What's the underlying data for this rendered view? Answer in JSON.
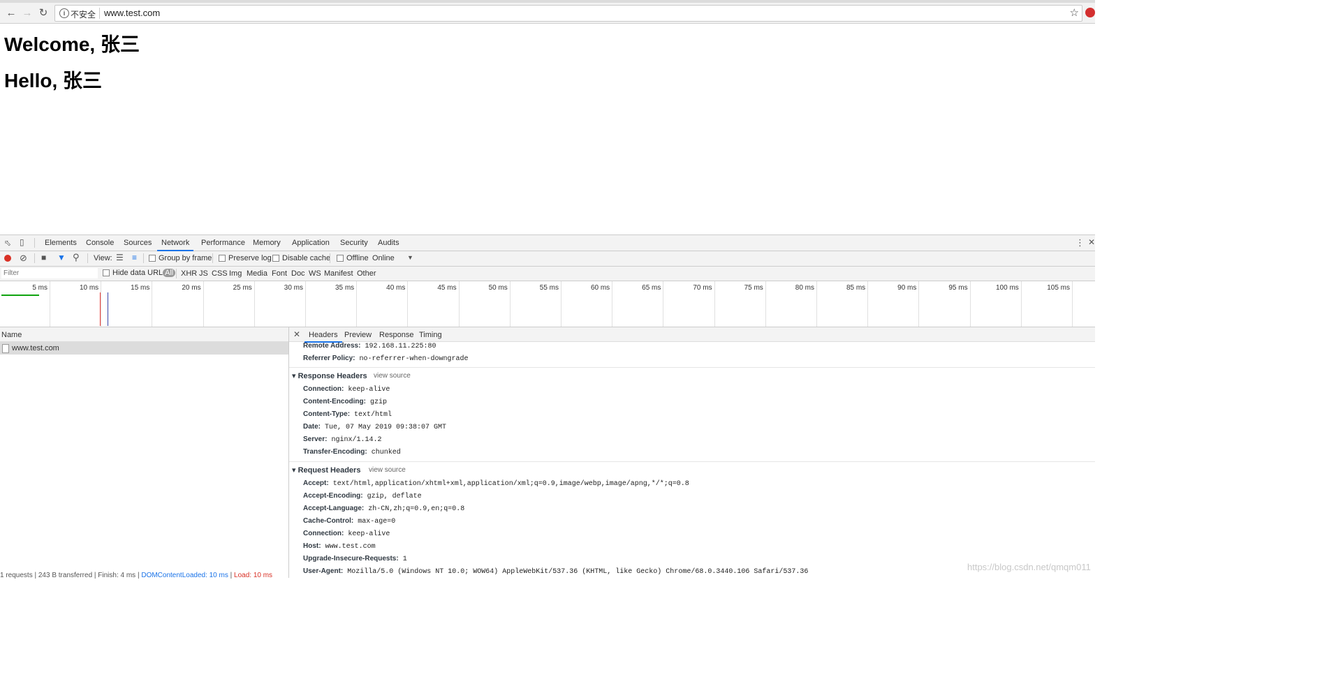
{
  "browser": {
    "security_label": "不安全",
    "url": "www.test.com"
  },
  "page": {
    "heading1": "Welcome, 张三",
    "heading2": "Hello, 张三"
  },
  "devtools": {
    "tabs": [
      "Elements",
      "Console",
      "Sources",
      "Network",
      "Performance",
      "Memory",
      "Application",
      "Security",
      "Audits"
    ],
    "active_tab": "Network",
    "network_toolbar": {
      "view_label": "View:",
      "group_by_frame": "Group by frame",
      "preserve_log": "Preserve log",
      "disable_cache": "Disable cache",
      "offline": "Offline",
      "throttle": "Online"
    },
    "filter": {
      "placeholder": "Filter",
      "hide_data_urls": "Hide data URLs",
      "types": [
        "All",
        "XHR",
        "JS",
        "CSS",
        "Img",
        "Media",
        "Font",
        "Doc",
        "WS",
        "Manifest",
        "Other"
      ]
    },
    "timeline_ticks": [
      "5 ms",
      "10 ms",
      "15 ms",
      "20 ms",
      "25 ms",
      "30 ms",
      "35 ms",
      "40 ms",
      "45 ms",
      "50 ms",
      "55 ms",
      "60 ms",
      "65 ms",
      "70 ms",
      "75 ms",
      "80 ms",
      "85 ms",
      "90 ms",
      "95 ms",
      "100 ms",
      "105 ms"
    ],
    "requests": {
      "column": "Name",
      "rows": [
        "www.test.com"
      ],
      "status": {
        "requests": "1 requests",
        "transferred": "243 B transferred",
        "finish": "Finish: 4 ms",
        "dcl": "DOMContentLoaded: 10 ms",
        "load": "Load: 10 ms"
      }
    },
    "details": {
      "tabs": [
        "Headers",
        "Preview",
        "Response",
        "Timing"
      ],
      "general": [
        {
          "k": "Remote Address:",
          "v": "192.168.11.225:80"
        },
        {
          "k": "Referrer Policy:",
          "v": "no-referrer-when-downgrade"
        }
      ],
      "response_title": "Response Headers",
      "response_view_source": "view source",
      "response_headers": [
        {
          "k": "Connection:",
          "v": "keep-alive"
        },
        {
          "k": "Content-Encoding:",
          "v": "gzip"
        },
        {
          "k": "Content-Type:",
          "v": "text/html"
        },
        {
          "k": "Date:",
          "v": "Tue, 07 May 2019 09:38:07 GMT"
        },
        {
          "k": "Server:",
          "v": "nginx/1.14.2"
        },
        {
          "k": "Transfer-Encoding:",
          "v": "chunked"
        }
      ],
      "request_title": "Request Headers",
      "request_view_source": "view source",
      "request_headers": [
        {
          "k": "Accept:",
          "v": "text/html,application/xhtml+xml,application/xml;q=0.9,image/webp,image/apng,*/*;q=0.8"
        },
        {
          "k": "Accept-Encoding:",
          "v": "gzip, deflate"
        },
        {
          "k": "Accept-Language:",
          "v": "zh-CN,zh;q=0.9,en;q=0.8"
        },
        {
          "k": "Cache-Control:",
          "v": "max-age=0"
        },
        {
          "k": "Connection:",
          "v": "keep-alive"
        },
        {
          "k": "Host:",
          "v": "www.test.com"
        },
        {
          "k": "Upgrade-Insecure-Requests:",
          "v": "1"
        },
        {
          "k": "User-Agent:",
          "v": "Mozilla/5.0 (Windows NT 10.0; WOW64) AppleWebKit/537.36 (KHTML, like Gecko) Chrome/68.0.3440.106 Safari/537.36"
        }
      ]
    }
  },
  "watermark": "https://blog.csdn.net/qmqm011"
}
